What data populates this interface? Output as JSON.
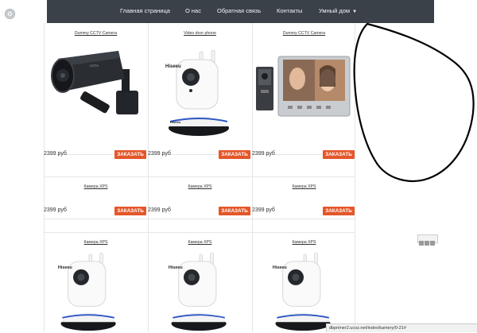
{
  "nav": {
    "items": [
      "Главная страница",
      "О нас",
      "Обратная связь",
      "Контакты",
      "Умный дом"
    ]
  },
  "currency": "руб",
  "order_label": "ЗАКАЗАТЬ",
  "products": [
    {
      "title": "Dummy CCTV Camera",
      "price": "2399 руб",
      "image": "bullet-camera-icon"
    },
    {
      "title": "Video door phone",
      "price": "2399 руб",
      "image": "ip-camera-icon"
    },
    {
      "title": "Dummy CCTV Camera",
      "price": "2399 руб",
      "image": "video-intercom-icon"
    },
    {
      "title": "Камера XPS",
      "price": "2399 руб",
      "image": ""
    },
    {
      "title": "Камера XPS",
      "price": "2399 руб",
      "image": ""
    },
    {
      "title": "Камера XPS",
      "price": "2399 руб",
      "image": ""
    },
    {
      "title": "Камера XPS",
      "price": "",
      "image": "ip-camera-icon"
    },
    {
      "title": "Камера XPS",
      "price": "",
      "image": "ip-camera-icon"
    },
    {
      "title": "Камера XPS",
      "price": "",
      "image": "ip-camera-icon"
    }
  ],
  "status_url": "dbprimer2.ucoz.net/index/kamery/0-21#",
  "colors": {
    "nav_bg": "#3a4148",
    "order_bg": "#e4572a"
  }
}
